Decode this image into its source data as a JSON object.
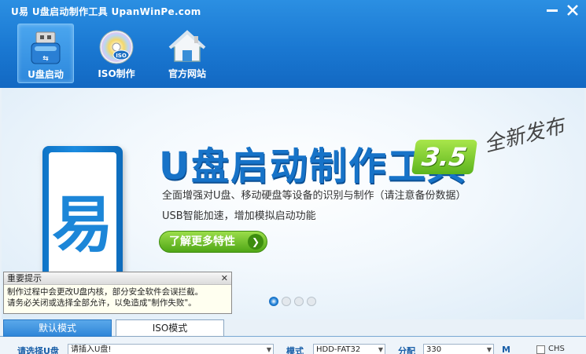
{
  "window": {
    "title": "U易  U盘启动制作工具  UpanWinPe.com"
  },
  "toolbar": {
    "items": [
      {
        "label": "U盘启动",
        "icon": "usb-drive-icon",
        "active": true
      },
      {
        "label": "ISO制作",
        "icon": "iso-disc-icon",
        "active": false
      },
      {
        "label": "官方网站",
        "icon": "home-icon",
        "active": false
      }
    ]
  },
  "banner": {
    "logo_char": "易",
    "title": "U盘启动制作工具",
    "version": "3.5",
    "tagline": "全新发布",
    "desc1": "全面增强对U盘、移动硬盘等设备的识别与制作（请注意备份数据）",
    "desc2": "USB智能加速，增加模拟启动功能",
    "more_label": "了解更多特性",
    "slide_count": 4,
    "active_slide": 0
  },
  "notice": {
    "title": "重要提示",
    "line1": "制作过程中会更改U盘内核，部分安全软件会误拦截。",
    "line2": "请务必关闭或选择全部允许，以免造成\"制作失败\"。"
  },
  "tabs": [
    {
      "label": "默认模式",
      "active": true
    },
    {
      "label": "ISO模式",
      "active": false
    }
  ],
  "controls": {
    "select_drive_label": "请选择U盘",
    "drive_value": "请插入U盘!",
    "mode_label": "模式",
    "mode_value": "HDD-FAT32",
    "partition_label": "分配",
    "partition_value": "330",
    "extra_label": "M",
    "chs_label": "CHS"
  },
  "colors": {
    "accent": "#1a78d2",
    "green": "#5cb41d"
  }
}
